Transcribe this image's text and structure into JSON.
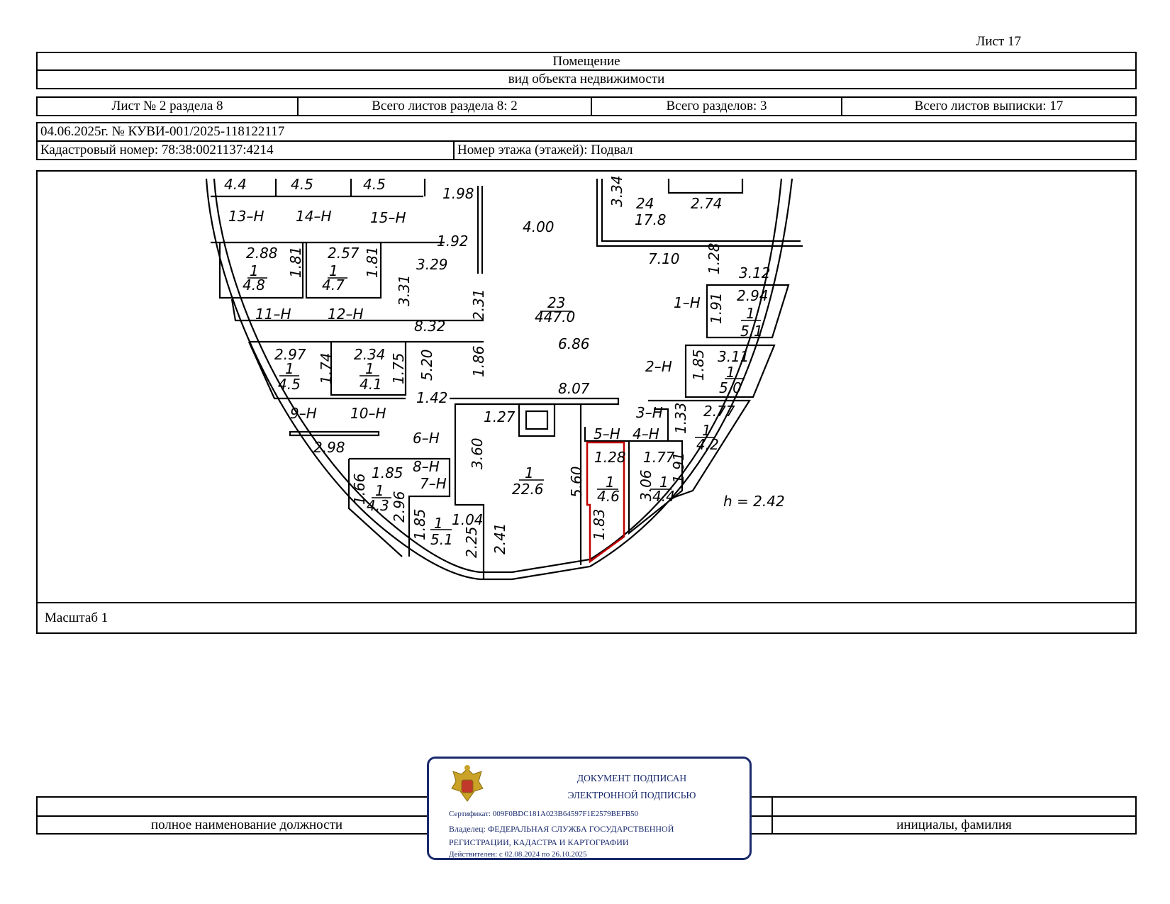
{
  "header": {
    "sheet_label": "Лист 17",
    "object_title": "Помещение",
    "object_subtitle": "вид объекта недвижимости"
  },
  "section_info": {
    "sheet_no": "Лист № 2 раздела 8",
    "total_sheets_section": "Всего листов раздела 8: 2",
    "total_sections": "Всего разделов: 3",
    "total_sheets": "Всего листов выписки: 17"
  },
  "doc": {
    "date_number": "04.06.2025г. № КУВИ-001/2025-118122117",
    "cadastral": "Кадастровый номер: 78:38:0021137:4214",
    "floor": "Номер этажа (этажей): Подвал"
  },
  "plan": {
    "height_note": "h = 2.42",
    "highlight_color": "#c00000",
    "labels": [
      "4.4",
      "4.5",
      "4.5",
      "13–Н",
      "14–Н",
      "15–Н",
      "1.98",
      "4.00",
      "3.34",
      "24",
      "17.8",
      "2.74",
      "2.88",
      "1",
      "4.8",
      "1.81",
      "2.57",
      "1",
      "4.7",
      "1.81",
      "1.92",
      "3.29",
      "3.31",
      "11–Н",
      "12–Н",
      "7.10",
      "1.28",
      "3.12",
      "1–Н",
      "2.94",
      "1.91",
      "1",
      "5.1",
      "23",
      "447.0",
      "2.31",
      "8.32",
      "6.86",
      "2.97",
      "1",
      "4.5",
      "1.74",
      "2.34",
      "1",
      "4.1",
      "1.75",
      "5.20",
      "1.86",
      "3.11",
      "2–Н",
      "1.85",
      "1",
      "5.0",
      "1.42",
      "8.07",
      "9–Н",
      "10–Н",
      "1.27",
      "3–Н",
      "2.77",
      "1.33",
      "5–Н",
      "4–Н",
      "1",
      "4.2",
      "6–Н",
      "2.98",
      "3.60",
      "1.28",
      "1.77",
      "8–Н",
      "1.85",
      "7–Н",
      "1.66",
      "1",
      "4.3",
      "2.96",
      "1",
      "22.6",
      "5.60",
      "1",
      "4.6",
      "3.06",
      "1",
      "4.4",
      "1.91",
      "1.85",
      "1",
      "5.1",
      "1.04",
      "2.25",
      "2.41",
      "1.83"
    ]
  },
  "scale_label": "Масштаб 1",
  "signature": {
    "position_label": "полное наименование должности",
    "name_label": "инициалы, фамилия"
  },
  "stamp": {
    "title1": "ДОКУМЕНТ ПОДПИСАН",
    "title2": "ЭЛЕКТРОННОЙ ПОДПИСЬЮ",
    "cert": "Сертификат: 009F0BDC181A023B64597F1E2579BEFB50",
    "owner1": "Владелец: ФЕДЕРАЛЬНАЯ СЛУЖБА ГОСУДАРСТВЕННОЙ",
    "owner2": "РЕГИСТРАЦИИ, КАДАСТРА И КАРТОГРАФИИ",
    "valid": "Действителен: с 02.08.2024 по 26.10.2025",
    "color": "#1a2a6c"
  }
}
